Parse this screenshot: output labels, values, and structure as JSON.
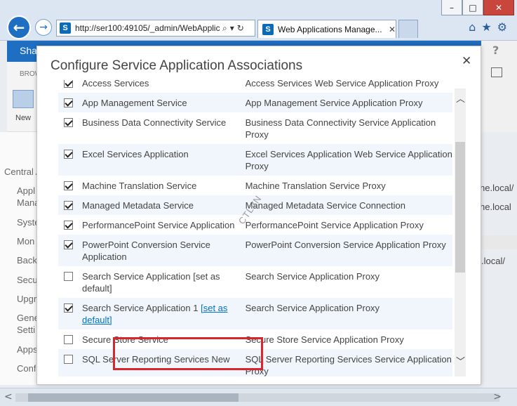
{
  "browser": {
    "window_buttons": [
      "–",
      "□",
      "✕"
    ],
    "back_glyph": "←",
    "forward_glyph": "→",
    "url": "http://ser100:49105/_admin/WebApplic",
    "address_icons": [
      "⌕",
      "▾",
      "↻"
    ],
    "tab_title": "Web Applications Manage...",
    "tab_close": "✕",
    "toolbar_icons": [
      "⌂",
      "★",
      "⚙"
    ]
  },
  "page": {
    "bar_text": "Sha",
    "ribbon_tab": "BROW",
    "new_label": "New",
    "help_glyph": "?",
    "left_nav_heading": "Central A",
    "left_nav": [
      "Appl",
      "Mana",
      "Syste",
      "Mon",
      "Back",
      "Secu",
      "Upgr",
      "Gene",
      "Setti",
      "Apps",
      "Conf"
    ],
    "right_urls": [
      "he.local/",
      "he.local",
      ".local/"
    ],
    "scroll_left": "<",
    "scroll_right": ">"
  },
  "dialog": {
    "title": "Configure Service Application Associations",
    "close_glyph": "✕",
    "scroll_up": "︿",
    "scroll_down": "﹀",
    "watermark": "CTLVN",
    "rows": [
      {
        "checked": true,
        "name": "Access Services",
        "proxy": "Access Services Web Service Application Proxy",
        "link": ""
      },
      {
        "checked": true,
        "name": "App Management Service",
        "proxy": "App Management Service Application Proxy",
        "link": ""
      },
      {
        "checked": true,
        "name": "Business Data Connectivity Service",
        "proxy": "Business Data Connectivity Service Application Proxy",
        "link": ""
      },
      {
        "checked": true,
        "name": "Excel Services Application",
        "proxy": "Excel Services Application Web Service Application Proxy",
        "link": ""
      },
      {
        "checked": true,
        "name": "Machine Translation Service",
        "proxy": "Machine Translation Service Proxy",
        "link": ""
      },
      {
        "checked": true,
        "name": "Managed Metadata Service",
        "proxy": "Managed Metadata Service Connection",
        "link": ""
      },
      {
        "checked": true,
        "name": "PerformancePoint Service Application",
        "proxy": "PerformancePoint Service Application Proxy",
        "link": ""
      },
      {
        "checked": true,
        "name": "PowerPoint Conversion Service Application",
        "proxy": "PowerPoint Conversion Service Application Proxy",
        "link": ""
      },
      {
        "checked": false,
        "name": "Search Service Application [set as default]",
        "proxy": "Search Service Application Proxy",
        "link": ""
      },
      {
        "checked": true,
        "name": "Search Service Application 1 ",
        "proxy": "Search Service Application Proxy",
        "link": "[set as default]"
      },
      {
        "checked": false,
        "name": "Secure Store Service",
        "proxy": "Secure Store Service Application Proxy",
        "link": ""
      },
      {
        "checked": false,
        "name": "SQL Server Reporting Services New",
        "proxy": "SQL Server Reporting Services Service Application Proxy",
        "link": ""
      }
    ]
  }
}
